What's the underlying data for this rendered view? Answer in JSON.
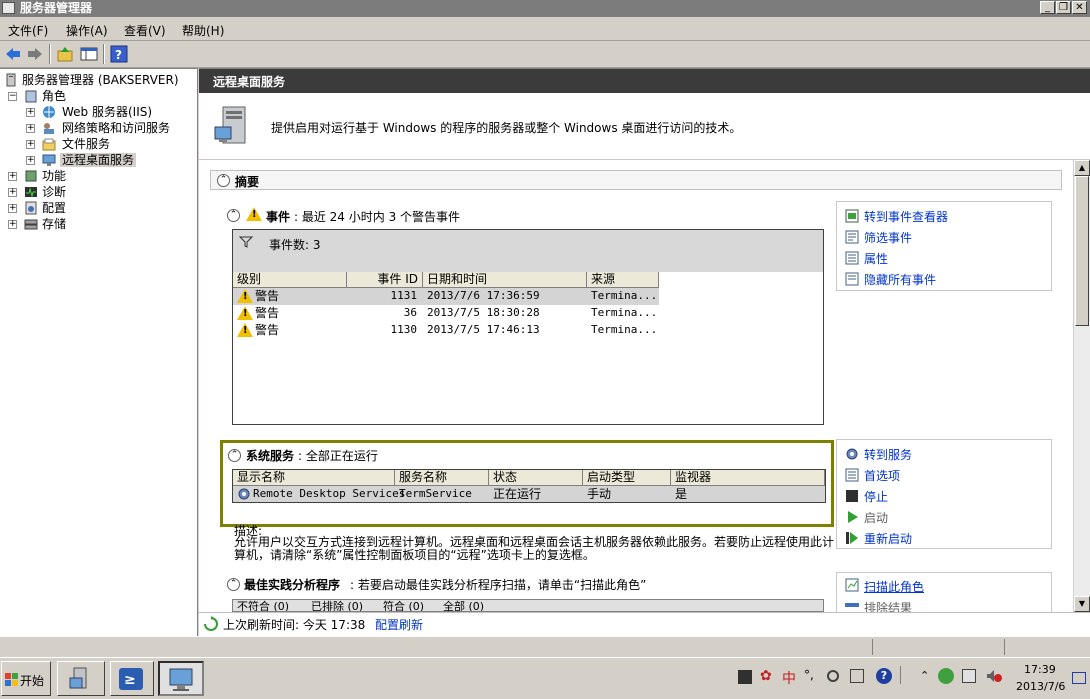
{
  "window": {
    "title": "服务器管理器"
  },
  "menu": {
    "items": [
      "文件(F)",
      "操作(A)",
      "查看(V)",
      "帮助(H)"
    ]
  },
  "tree": {
    "root": "服务器管理器 (BAKSERVER)",
    "roles": "角色",
    "role_items": [
      "Web 服务器(IIS)",
      "网络策略和访问服务",
      "文件服务",
      "远程桌面服务"
    ],
    "features": "功能",
    "diagnostics": "诊断",
    "configuration": "配置",
    "storage": "存储"
  },
  "main": {
    "header": "远程桌面服务",
    "description": "提供启用对运行基于 Windows 的程序的服务器或整个 Windows 桌面进行访问的技术。",
    "summary_title": "摘要",
    "events": {
      "title": "事件",
      "subtitle": ": 最近 24 小时内 3 个警告事件",
      "filter_label": "事件数: 3",
      "columns": [
        "级别",
        "事件 ID",
        "日期和时间",
        "来源"
      ],
      "rows": [
        {
          "level": "警告",
          "id": "1131",
          "datetime": "2013/7/6 17:36:59",
          "source": "Termina..."
        },
        {
          "level": "警告",
          "id": "36",
          "datetime": "2013/7/5 18:30:28",
          "source": "Termina..."
        },
        {
          "level": "警告",
          "id": "1130",
          "datetime": "2013/7/5 17:46:13",
          "source": "Termina..."
        }
      ],
      "actions": [
        "转到事件查看器",
        "筛选事件",
        "属性",
        "隐藏所有事件"
      ]
    },
    "services": {
      "title": "系统服务",
      "subtitle": ": 全部正在运行",
      "columns": [
        "显示名称",
        "服务名称",
        "状态",
        "启动类型",
        "监视器"
      ],
      "rows": [
        {
          "display": "Remote Desktop Services",
          "name": "TermService",
          "status": "正在运行",
          "startup": "手动",
          "monitor": "是"
        }
      ],
      "desc_label": "描述:",
      "description": "允许用户以交互方式连接到远程计算机。远程桌面和远程桌面会话主机服务器依赖此服务。若要防止远程使用此计算机，请清除“系统”属性控制面板项目的“远程”选项卡上的复选框。",
      "actions": [
        "转到服务",
        "首选项",
        "停止",
        "启动",
        "重新启动"
      ]
    },
    "bpa": {
      "title": "最佳实践分析程序",
      "subtitle": ": 若要启动最佳实践分析程序扫描，请单击“扫描此角色”",
      "tabs": [
        "不符合 (0)",
        "已排除 (0)",
        "符合 (0)",
        "全部 (0)"
      ],
      "actions": [
        "扫描此角色",
        "排除结果"
      ]
    },
    "status": {
      "last_refresh_label": "上次刷新时间: 今天 17:38",
      "config_refresh": "配置刷新"
    }
  },
  "taskbar": {
    "start": "开始",
    "clock_time": "17:39",
    "clock_date": "2013/7/6",
    "ime": "中"
  },
  "colors": {
    "header_bg": "#3b3b3b",
    "highlight_border": "#7f7f00",
    "link": "#0033cc"
  }
}
